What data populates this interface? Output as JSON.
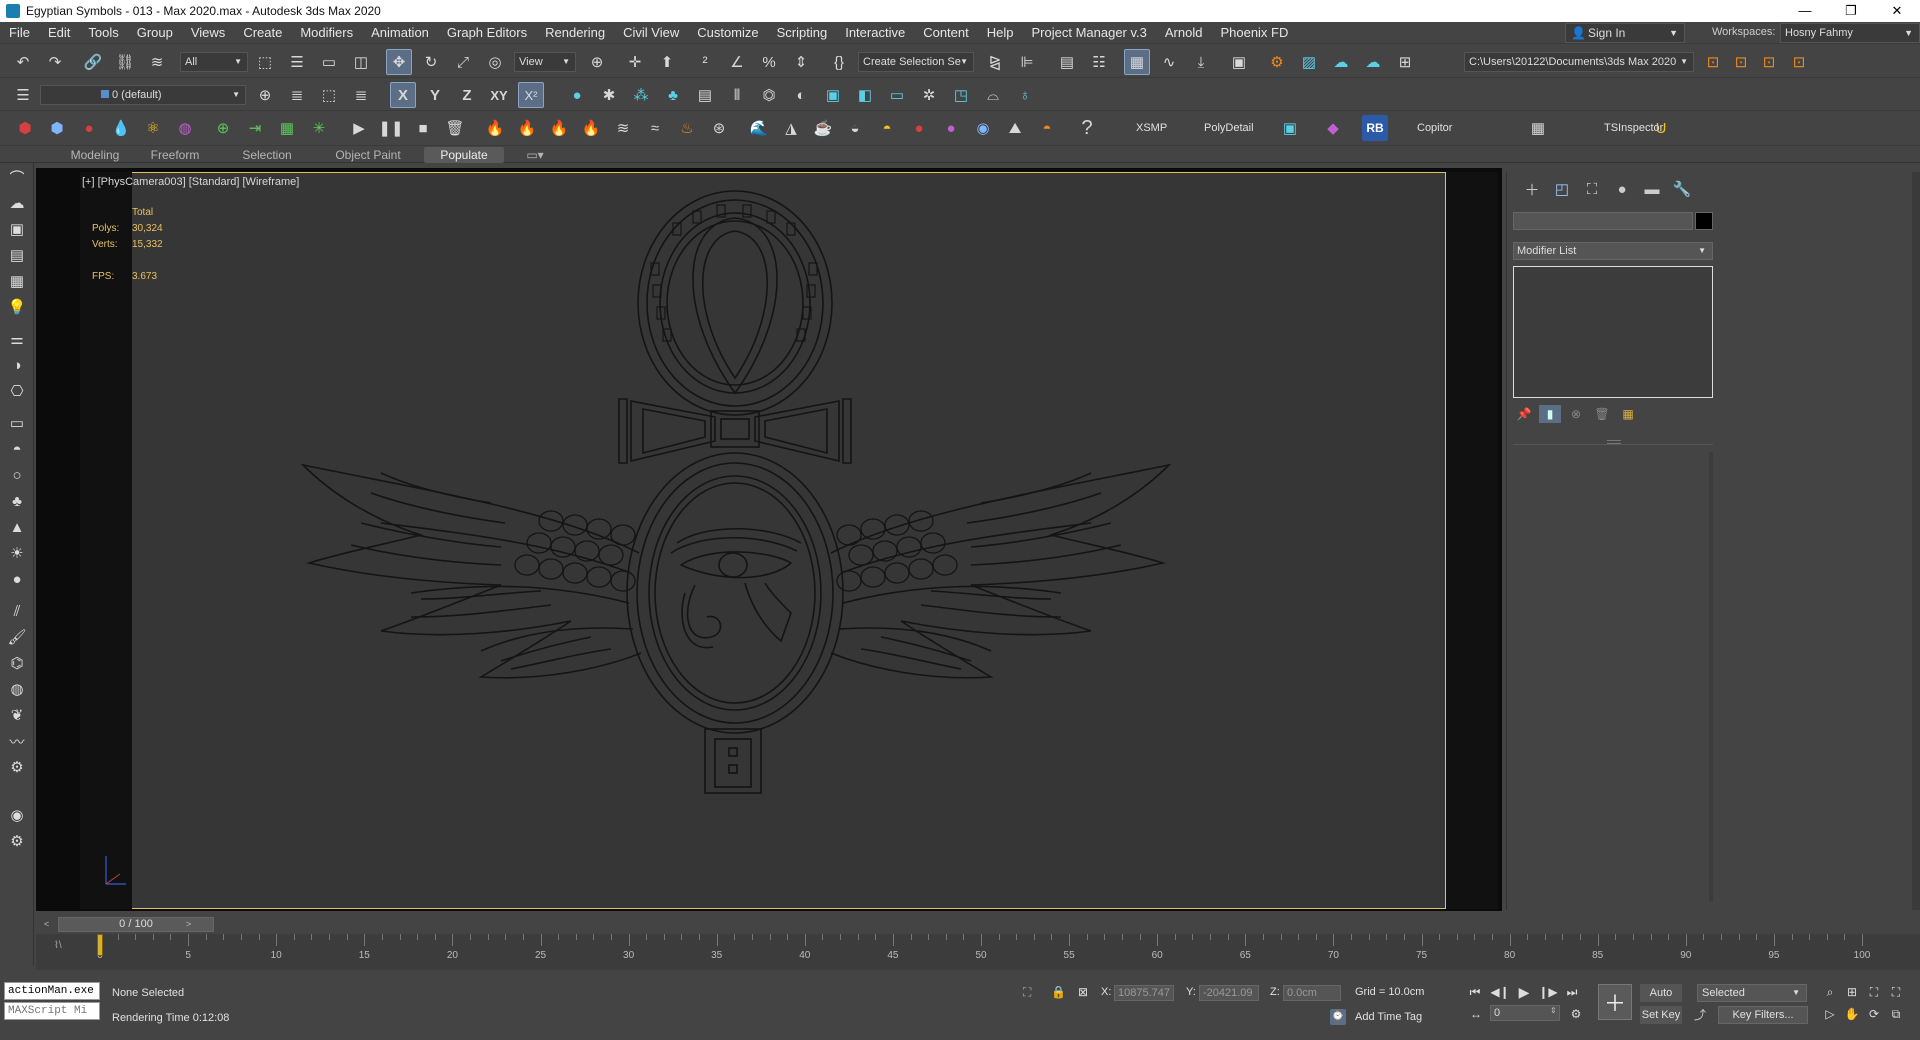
{
  "window": {
    "title": "Egyptian Symbols - 013 - Max 2020.max - Autodesk 3ds Max 2020",
    "controls": [
      "—",
      "❐",
      "✕"
    ]
  },
  "menu": [
    "File",
    "Edit",
    "Tools",
    "Group",
    "Views",
    "Create",
    "Modifiers",
    "Animation",
    "Graph Editors",
    "Rendering",
    "Civil View",
    "Customize",
    "Scripting",
    "Interactive",
    "Content",
    "Help",
    "Project Manager v.3",
    "Arnold",
    "Phoenix FD"
  ],
  "account": {
    "sign_in": "Sign In",
    "workspaces_label": "Workspaces:",
    "workspace": "Hosny Fahmy"
  },
  "toolbar1": {
    "filter_select": "All",
    "view_select": "View",
    "named_selection": "Create Selection Se",
    "project_path": "C:\\Users\\20122\\Documents\\3ds Max 2020"
  },
  "toolbar2": {
    "layer_select": "0 (default)"
  },
  "toolbar3": {
    "xsmp": "XSMP",
    "polydetail": "PolyDetail",
    "rb": "RB",
    "copitor": "Copitor",
    "tsinspector": "TSInspector"
  },
  "ribbon_tabs": [
    "Modeling",
    "Freeform",
    "Selection",
    "Object Paint",
    "Populate"
  ],
  "viewport": {
    "label": "[+] [PhysCamera003] [Standard] [Wireframe]",
    "stats": {
      "header": "Total",
      "polys_label": "Polys:",
      "polys": "30,324",
      "verts_label": "Verts:",
      "verts": "15,332",
      "fps_label": "FPS:",
      "fps": "3.673"
    }
  },
  "command_panel": {
    "modifier_list": "Modifier List"
  },
  "timeline": {
    "frame_counter": "0 / 100",
    "ticks": [
      "0",
      "5",
      "10",
      "15",
      "20",
      "25",
      "30",
      "35",
      "40",
      "45",
      "50",
      "55",
      "60",
      "65",
      "70",
      "75",
      "80",
      "85",
      "90",
      "95",
      "100"
    ]
  },
  "status": {
    "maxscript_line1": "actionMan.exe",
    "maxscript_line2": "MAXScript Mi",
    "selection": "None Selected",
    "render_time": "Rendering Time  0:12:08",
    "x_label": "X:",
    "x_value": "10875.747",
    "y_label": "Y:",
    "y_value": "-20421.09",
    "z_label": "Z:",
    "z_value": "0.0cm",
    "grid": "Grid = 10.0cm",
    "add_time_tag": "Add Time Tag",
    "frame_value": "0",
    "auto_key": "Auto Key",
    "set_key": "Set Key",
    "selected": "Selected",
    "key_filters": "Key Filters..."
  },
  "colors": {
    "viewport_bg": "#363636",
    "viewport_border": "#e0c060",
    "stats_text": "#e8c060",
    "active_button": "#5b6e86"
  }
}
